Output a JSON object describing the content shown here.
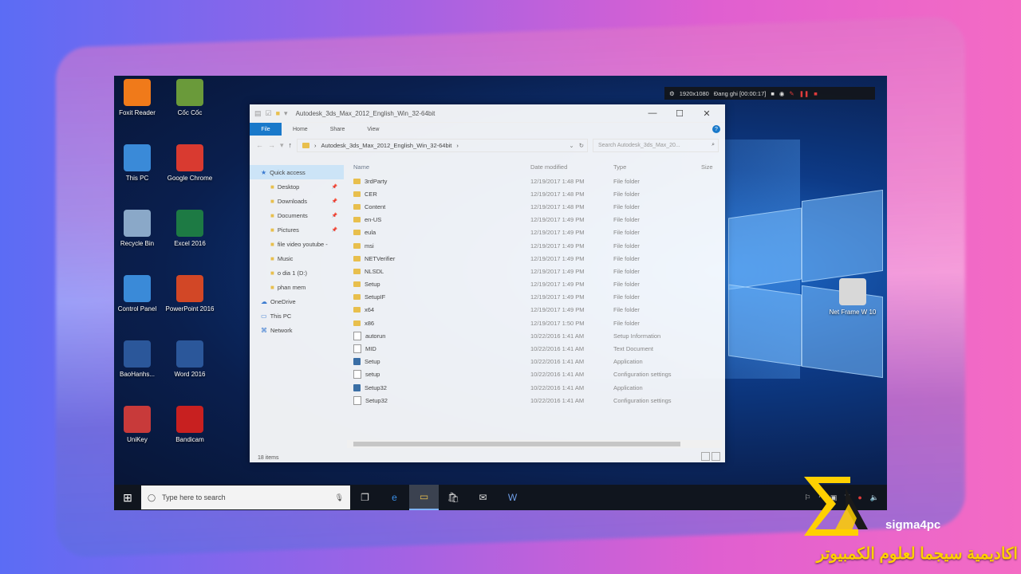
{
  "desktop_icons": [
    {
      "label": "Foxit Reader",
      "icon": "foxit-icon",
      "color": "#f07a1a"
    },
    {
      "label": "Cốc Cốc",
      "icon": "coccoc-icon",
      "color": "#6a9a3a"
    },
    {
      "label": "This PC",
      "icon": "computer-icon",
      "color": "#3a8ad8"
    },
    {
      "label": "Google Chrome",
      "icon": "chrome-icon",
      "color": "#d93a30"
    },
    {
      "label": "Recycle Bin",
      "icon": "recycle-bin-icon",
      "color": "#8aa8c8"
    },
    {
      "label": "Excel 2016",
      "icon": "excel-icon",
      "color": "#1d7a44"
    },
    {
      "label": "Control Panel",
      "icon": "control-panel-icon",
      "color": "#3a8ad8"
    },
    {
      "label": "PowerPoint 2016",
      "icon": "powerpoint-icon",
      "color": "#d24726"
    },
    {
      "label": "BaoHanhs...",
      "icon": "word-doc-icon",
      "color": "#2b579a"
    },
    {
      "label": "Word 2016",
      "icon": "word-icon",
      "color": "#2b579a"
    },
    {
      "label": "UniKey",
      "icon": "unikey-icon",
      "color": "#c83a3a"
    },
    {
      "label": "Bandicam",
      "icon": "bandicam-icon",
      "color": "#c82020"
    },
    {
      "label": "Net Frame W 10",
      "icon": "setup-file-icon",
      "color": "#d8d8d8"
    }
  ],
  "recorder": {
    "resolution": "1920x1080",
    "status": "Đang ghi [00:00:17]"
  },
  "explorer": {
    "title": "Autodesk_3ds_Max_2012_English_Win_32-64bit",
    "ribbon_tabs": [
      "File",
      "Home",
      "Share",
      "View"
    ],
    "address": "Autodesk_3ds_Max_2012_English_Win_32-64bit",
    "search_placeholder": "Search Autodesk_3ds_Max_20...",
    "nav": [
      {
        "label": "Quick access",
        "level": 0,
        "icon": "star-icon",
        "pinned": false,
        "active": true
      },
      {
        "label": "Desktop",
        "level": 1,
        "icon": "desktop-icon",
        "pinned": true,
        "active": false
      },
      {
        "label": "Downloads",
        "level": 1,
        "icon": "downloads-icon",
        "pinned": true,
        "active": false
      },
      {
        "label": "Documents",
        "level": 1,
        "icon": "documents-icon",
        "pinned": true,
        "active": false
      },
      {
        "label": "Pictures",
        "level": 1,
        "icon": "pictures-icon",
        "pinned": true,
        "active": false
      },
      {
        "label": "file video youtube -",
        "level": 1,
        "icon": "folder-icon",
        "pinned": false,
        "active": false
      },
      {
        "label": "Music",
        "level": 1,
        "icon": "music-icon",
        "pinned": false,
        "active": false
      },
      {
        "label": "o dia 1 (D:)",
        "level": 1,
        "icon": "drive-icon",
        "pinned": false,
        "active": false
      },
      {
        "label": "phan mem",
        "level": 1,
        "icon": "folder-icon",
        "pinned": false,
        "active": false
      },
      {
        "label": "OneDrive",
        "level": 0,
        "icon": "cloud-icon",
        "pinned": false,
        "active": false
      },
      {
        "label": "This PC",
        "level": 0,
        "icon": "computer-icon",
        "pinned": false,
        "active": false
      },
      {
        "label": "Network",
        "level": 0,
        "icon": "network-icon",
        "pinned": false,
        "active": false
      }
    ],
    "columns": [
      "Name",
      "Date modified",
      "Type",
      "Size"
    ],
    "files": [
      {
        "name": "3rdParty",
        "date": "12/19/2017 1:48 PM",
        "type": "File folder",
        "kind": "folder"
      },
      {
        "name": "CER",
        "date": "12/19/2017 1:48 PM",
        "type": "File folder",
        "kind": "folder"
      },
      {
        "name": "Content",
        "date": "12/19/2017 1:48 PM",
        "type": "File folder",
        "kind": "folder"
      },
      {
        "name": "en-US",
        "date": "12/19/2017 1:49 PM",
        "type": "File folder",
        "kind": "folder"
      },
      {
        "name": "eula",
        "date": "12/19/2017 1:49 PM",
        "type": "File folder",
        "kind": "folder"
      },
      {
        "name": "msi",
        "date": "12/19/2017 1:49 PM",
        "type": "File folder",
        "kind": "folder"
      },
      {
        "name": "NETVerifier",
        "date": "12/19/2017 1:49 PM",
        "type": "File folder",
        "kind": "folder"
      },
      {
        "name": "NLSDL",
        "date": "12/19/2017 1:49 PM",
        "type": "File folder",
        "kind": "folder"
      },
      {
        "name": "Setup",
        "date": "12/19/2017 1:49 PM",
        "type": "File folder",
        "kind": "folder"
      },
      {
        "name": "SetupIF",
        "date": "12/19/2017 1:49 PM",
        "type": "File folder",
        "kind": "folder"
      },
      {
        "name": "x64",
        "date": "12/19/2017 1:49 PM",
        "type": "File folder",
        "kind": "folder"
      },
      {
        "name": "x86",
        "date": "12/19/2017 1:50 PM",
        "type": "File folder",
        "kind": "folder"
      },
      {
        "name": "autorun",
        "date": "10/22/2016 1:41 AM",
        "type": "Setup Information",
        "kind": "file"
      },
      {
        "name": "MID",
        "date": "10/22/2016 1:41 AM",
        "type": "Text Document",
        "kind": "file"
      },
      {
        "name": "Setup",
        "date": "10/22/2016 1:41 AM",
        "type": "Application",
        "kind": "app"
      },
      {
        "name": "setup",
        "date": "10/22/2016 1:41 AM",
        "type": "Configuration settings",
        "kind": "file"
      },
      {
        "name": "Setup32",
        "date": "10/22/2016 1:41 AM",
        "type": "Application",
        "kind": "app"
      },
      {
        "name": "Setup32",
        "date": "10/22/2016 1:41 AM",
        "type": "Configuration settings",
        "kind": "file"
      }
    ],
    "status": "18 items"
  },
  "taskbar": {
    "search_placeholder": "Type here to search",
    "apps": [
      {
        "icon": "task-view-icon",
        "active": false
      },
      {
        "icon": "edge-icon",
        "active": false
      },
      {
        "icon": "file-explorer-icon",
        "active": true
      },
      {
        "icon": "store-icon",
        "active": false
      },
      {
        "icon": "mail-icon",
        "active": false
      },
      {
        "icon": "word-icon",
        "active": false
      }
    ]
  },
  "brand": {
    "name": "sigma4pc",
    "arabic": "اكاديمية سيجما لعلوم الكمبيوتر",
    "accent": "#ffd000"
  }
}
